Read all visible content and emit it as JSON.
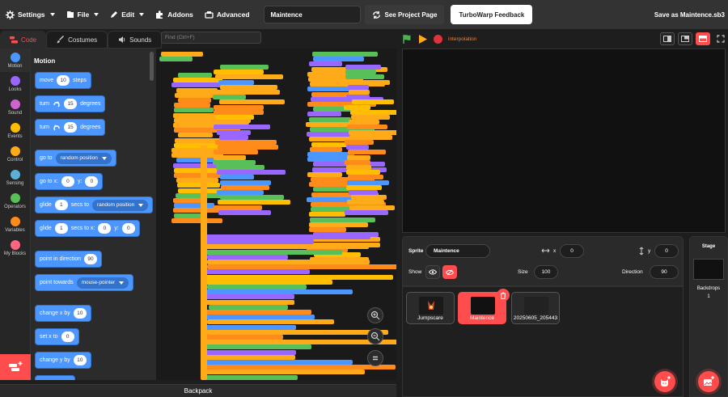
{
  "menu": {
    "settings": "Settings",
    "file": "File",
    "edit": "Edit",
    "addons": "Addons",
    "advanced": "Advanced",
    "project_title": "Maintence",
    "see_project": "See Project Page",
    "feedback": "TurboWarp Feedback",
    "save_as": "Save as Maintence.sb3"
  },
  "tabs": {
    "code": "Code",
    "costumes": "Costumes",
    "sounds": "Sounds"
  },
  "find_placeholder": "Find (Ctrl+F)",
  "categories": [
    {
      "label": "Motion",
      "color": "#4c97ff"
    },
    {
      "label": "Looks",
      "color": "#9966ff"
    },
    {
      "label": "Sound",
      "color": "#cf63cf"
    },
    {
      "label": "Events",
      "color": "#ffbf00"
    },
    {
      "label": "Control",
      "color": "#ffab19"
    },
    {
      "label": "Sensing",
      "color": "#5cb1d6"
    },
    {
      "label": "Operators",
      "color": "#59c059"
    },
    {
      "label": "Variables",
      "color": "#ff8c1a"
    },
    {
      "label": "My Blocks",
      "color": "#ff6680"
    }
  ],
  "palette": {
    "heading": "Motion",
    "move": {
      "a": "move",
      "v": "10",
      "b": "steps"
    },
    "turn_right": {
      "a": "turn",
      "v": "15",
      "b": "degrees"
    },
    "turn_left": {
      "a": "turn",
      "v": "15",
      "b": "degrees"
    },
    "goto": {
      "a": "go to",
      "dd": "random position"
    },
    "goto_xy": {
      "a": "go to x:",
      "x": "0",
      "b": "y:",
      "y": "0"
    },
    "glide_to": {
      "a": "glide",
      "v": "1",
      "b": "secs to",
      "dd": "random position"
    },
    "glide_xy": {
      "a": "glide",
      "v": "1",
      "b": "secs to x:",
      "x": "0",
      "c": "y:",
      "y": "0"
    },
    "point_dir": {
      "a": "point in direction",
      "v": "90"
    },
    "point_towards": {
      "a": "point towards",
      "dd": "mouse-pointer"
    },
    "change_x": {
      "a": "change x by",
      "v": "10"
    },
    "set_x": {
      "a": "set x to",
      "v": "0"
    },
    "change_y": {
      "a": "change y by",
      "v": "10"
    }
  },
  "backpack": "Backpack",
  "stage_bar": {
    "interpolation": "interpolation"
  },
  "sprite_info": {
    "sprite_label": "Sprite",
    "sprite_name": "Maintence",
    "x_label": "x",
    "x": "0",
    "y_label": "y",
    "y": "0",
    "show_label": "Show",
    "size_label": "Size",
    "size": "100",
    "direction_label": "Direction",
    "direction": "90"
  },
  "sprites": [
    {
      "name": "Jumpscare"
    },
    {
      "name": "Maintence"
    },
    {
      "name": "20250605_205443"
    }
  ],
  "stage_pane": {
    "title": "Stage",
    "backdrops_label": "Backdrops",
    "backdrops_count": "1"
  },
  "colors": {
    "accent": "#ff4c4c",
    "motion": "#4c97ff",
    "events": "#ffbf00",
    "control": "#ffab19",
    "operators": "#59c059",
    "variables": "#ff8c1a",
    "looks": "#9966ff"
  }
}
